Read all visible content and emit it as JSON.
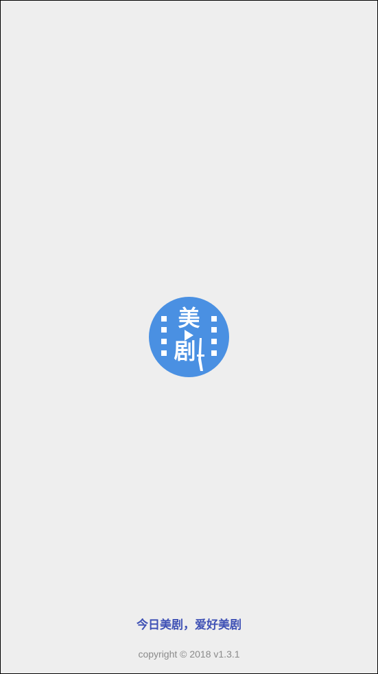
{
  "app": {
    "logo": {
      "icon": "film-strip-play-icon",
      "char_top": "美",
      "char_bottom": "剧",
      "color": "#4a90e2"
    },
    "slogan": "今日美剧，爱好美剧",
    "copyright": "copyright © 2018 v1.3.1"
  },
  "colors": {
    "background": "#eeeeee",
    "slogan": "#3f51b5",
    "copyright": "#8a8a8a"
  }
}
